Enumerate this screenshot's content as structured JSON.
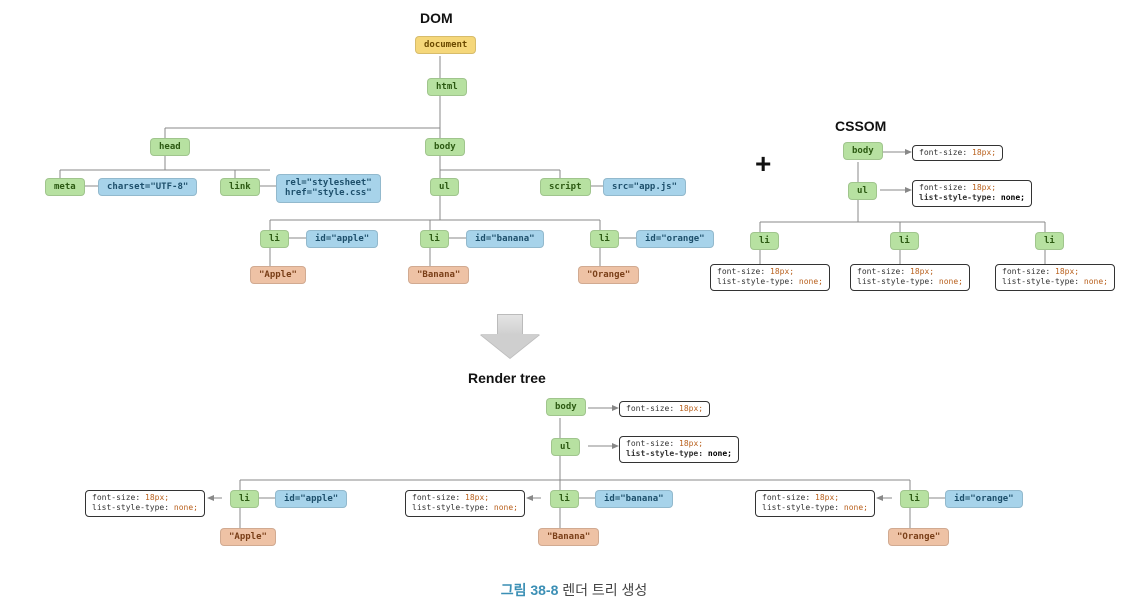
{
  "titles": {
    "dom": "DOM",
    "cssom": "CSSOM",
    "render": "Render tree"
  },
  "plus": "+",
  "caption": {
    "num": "그림 38-8",
    "txt": "렌더 트리 생성"
  },
  "dom": {
    "document": "document",
    "html": "html",
    "head": "head",
    "body": "body",
    "meta": "meta",
    "meta_attr": "charset=\"UTF-8\"",
    "link": "link",
    "link_attr": "rel=\"stylesheet\"\nhref=\"style.css\"",
    "ul": "ul",
    "script": "script",
    "script_attr": "src=\"app.js\"",
    "li": "li",
    "id_apple": "id=\"apple\"",
    "id_banana": "id=\"banana\"",
    "id_orange": "id=\"orange\"",
    "apple": "\"Apple\"",
    "banana": "\"Banana\"",
    "orange": "\"Orange\""
  },
  "css": {
    "fs": "font-size:",
    "fsv": "18px;",
    "lst": "list-style-type:",
    "lstv": "none;"
  },
  "cssom": {
    "body": "body",
    "ul": "ul",
    "li": "li"
  },
  "render": {
    "body": "body",
    "ul": "ul",
    "li": "li",
    "id_apple": "id=\"apple\"",
    "id_banana": "id=\"banana\"",
    "id_orange": "id=\"orange\"",
    "apple": "\"Apple\"",
    "banana": "\"Banana\"",
    "orange": "\"Orange\""
  },
  "chart_data": {
    "type": "diagram",
    "title": "렌더 트리 생성 (Render Tree Creation)",
    "dom_tree": {
      "document": {
        "html": {
          "head": {
            "meta": {
              "attrs": {
                "charset": "UTF-8"
              }
            },
            "link": {
              "attrs": {
                "rel": "stylesheet",
                "href": "style.css"
              }
            }
          },
          "body": {
            "ul": {
              "li#apple": {
                "text": "Apple"
              },
              "li#banana": {
                "text": "Banana"
              },
              "li#orange": {
                "text": "Orange"
              }
            },
            "script": {
              "attrs": {
                "src": "app.js"
              }
            }
          }
        }
      }
    },
    "cssom_tree": {
      "body": {
        "font-size": "18px",
        "ul": {
          "font-size": "18px",
          "list-style-type": "none",
          "li": [
            {
              "font-size": "18px",
              "list-style-type": "none"
            },
            {
              "font-size": "18px",
              "list-style-type": "none"
            },
            {
              "font-size": "18px",
              "list-style-type": "none"
            }
          ]
        }
      }
    },
    "render_tree": {
      "body": {
        "style": {
          "font-size": "18px"
        },
        "ul": {
          "style": {
            "font-size": "18px",
            "list-style-type": "none"
          },
          "children": [
            {
              "li": {
                "id": "apple",
                "style": {
                  "font-size": "18px",
                  "list-style-type": "none"
                },
                "text": "Apple"
              }
            },
            {
              "li": {
                "id": "banana",
                "style": {
                  "font-size": "18px",
                  "list-style-type": "none"
                },
                "text": "Banana"
              }
            },
            {
              "li": {
                "id": "orange",
                "style": {
                  "font-size": "18px",
                  "list-style-type": "none"
                },
                "text": "Orange"
              }
            }
          ]
        }
      }
    }
  }
}
